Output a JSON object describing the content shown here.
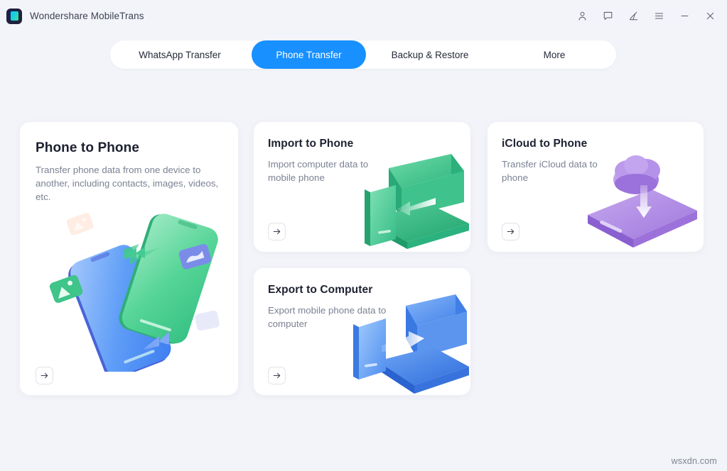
{
  "window": {
    "app_title": "Wondershare MobileTrans",
    "logo_icon": "mobiletrans-logo-icon",
    "controls": [
      {
        "name": "account-icon",
        "label": "Account"
      },
      {
        "name": "feedback-icon",
        "label": "Feedback"
      },
      {
        "name": "edit-icon",
        "label": "Edit"
      },
      {
        "name": "menu-icon",
        "label": "Menu"
      },
      {
        "name": "minimize-icon",
        "label": "Minimize"
      },
      {
        "name": "close-icon",
        "label": "Close"
      }
    ]
  },
  "tabs": [
    {
      "label": "WhatsApp Transfer",
      "active": false
    },
    {
      "label": "Phone Transfer",
      "active": true
    },
    {
      "label": "Backup & Restore",
      "active": false
    },
    {
      "label": "More",
      "active": false
    }
  ],
  "cards": {
    "phone_to_phone": {
      "title": "Phone to Phone",
      "description": "Transfer phone data from one device to another, including contacts, images, videos, etc.",
      "action_icon": "arrow-right-icon"
    },
    "import_to_phone": {
      "title": "Import to Phone",
      "description": "Import computer data to mobile phone",
      "action_icon": "arrow-right-icon"
    },
    "icloud_to_phone": {
      "title": "iCloud to Phone",
      "description": "Transfer iCloud data to phone",
      "action_icon": "arrow-right-icon"
    },
    "export_to_computer": {
      "title": "Export to Computer",
      "description": "Export mobile phone data to computer",
      "action_icon": "arrow-right-icon"
    }
  },
  "watermark": "wsxdn.com",
  "colors": {
    "background": "#f3f4f9",
    "card": "#ffffff",
    "accent_active_tab": "#1890ff",
    "title_text": "#1c2030",
    "body_text": "#7b8293",
    "green_illustration": "#3ec98a",
    "blue_illustration": "#4a90f2",
    "purple_illustration": "#a87fe0"
  }
}
